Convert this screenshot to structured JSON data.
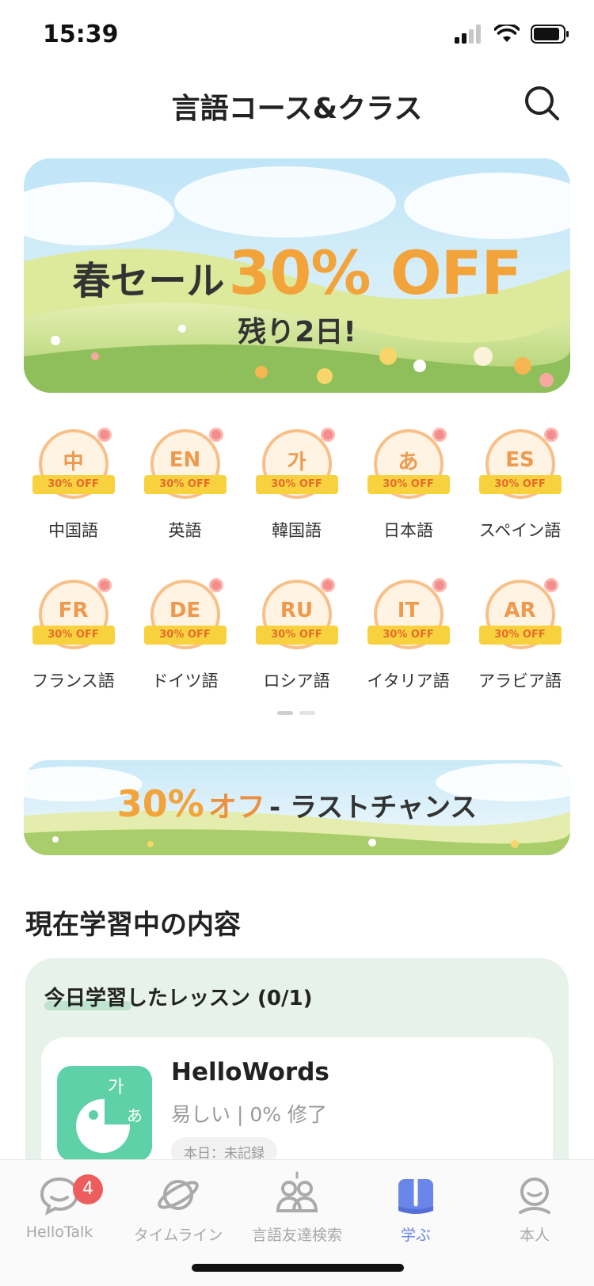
{
  "status_bar": {
    "time": "15:39"
  },
  "header": {
    "title": "言語コース&クラス"
  },
  "banner": {
    "title_prefix": "春セール",
    "title_discount": "30% OFF",
    "subtitle": "残り2日!"
  },
  "languages": [
    {
      "code": "中",
      "discount": "30% OFF",
      "label": "中国語"
    },
    {
      "code": "EN",
      "discount": "30% OFF",
      "label": "英語"
    },
    {
      "code": "가",
      "discount": "30% OFF",
      "label": "韓国語"
    },
    {
      "code": "あ",
      "discount": "30% OFF",
      "label": "日本語"
    },
    {
      "code": "ES",
      "discount": "30% OFF",
      "label": "スペイン語"
    },
    {
      "code": "FR",
      "discount": "30% OFF",
      "label": "フランス語"
    },
    {
      "code": "DE",
      "discount": "30% OFF",
      "label": "ドイツ語"
    },
    {
      "code": "RU",
      "discount": "30% OFF",
      "label": "ロシア語"
    },
    {
      "code": "IT",
      "discount": "30% OFF",
      "label": "イタリア語"
    },
    {
      "code": "AR",
      "discount": "30% OFF",
      "label": "アラビア語"
    }
  ],
  "promo": {
    "discount": "30%",
    "off": "オフ",
    "rest": " - ラストチャンス"
  },
  "section": {
    "title": "現在学習中の内容"
  },
  "study": {
    "card_title": "今日学習したレッスン (0/1)",
    "course": {
      "name": "HelloWords",
      "meta": "易しい | 0% 修了",
      "tag": "本日：未記録"
    }
  },
  "tabbar": {
    "items": [
      {
        "label": "HelloTalk",
        "badge": "4"
      },
      {
        "label": "タイムライン"
      },
      {
        "label": "言語友達検索"
      },
      {
        "label": "学ぶ"
      },
      {
        "label": "本人"
      }
    ]
  },
  "colors": {
    "accent_orange": "#F2A33A",
    "active_tab": "#6A86E8",
    "badge_red": "#EE5D5D",
    "study_bg": "#E7F3EA"
  }
}
